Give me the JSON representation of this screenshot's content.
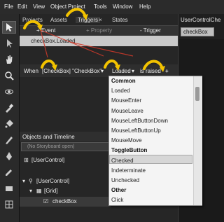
{
  "menu": {
    "items": [
      "File",
      "Edit",
      "View",
      "Object",
      "Project",
      "Tools",
      "Window",
      "Help"
    ]
  },
  "panel_tabs": {
    "items": [
      "Projects",
      "Assets",
      "Triggers",
      "States"
    ],
    "close_glyph": "×"
  },
  "event_bar": {
    "event_label": "+ Event",
    "property_label": "+ Property",
    "remove_label": "- Trigger"
  },
  "trigger_item": {
    "label": "checkBox.Loaded"
  },
  "when_row": {
    "when": "When",
    "source": "[CheckBox] \"CheckBox\"",
    "event": "Loaded",
    "raised": "is raised",
    "add": "+"
  },
  "dropdown": {
    "items": [
      {
        "text": "Common",
        "header": true
      },
      {
        "text": "Loaded",
        "header": false
      },
      {
        "text": "MouseEnter",
        "header": false
      },
      {
        "text": "MouseLeave",
        "header": false
      },
      {
        "text": "MouseLeftButtonDown",
        "header": false
      },
      {
        "text": "MouseLeftButtonUp",
        "header": false
      },
      {
        "text": "MouseMove",
        "header": false
      },
      {
        "text": "ToggleButton",
        "header": true
      },
      {
        "text": "Checked",
        "header": false
      },
      {
        "text": "Indeterminate",
        "header": false
      },
      {
        "text": "Unchecked",
        "header": false
      },
      {
        "text": "Other",
        "header": true
      },
      {
        "text": "Click",
        "header": false
      }
    ],
    "selected": "Checked"
  },
  "objects_timeline": {
    "title": "Objects and Timeline",
    "storyboard": "(No Storyboard open)",
    "tree": [
      "[UserControl]",
      "[UserControl]",
      "[Grid]",
      "checkBox"
    ]
  },
  "right_panel": {
    "tab": "UserControlChe",
    "chip": "checkBox"
  },
  "colors": {
    "highlight_arrow": "#f2c200",
    "selection_gray": "#c9c9c9"
  }
}
